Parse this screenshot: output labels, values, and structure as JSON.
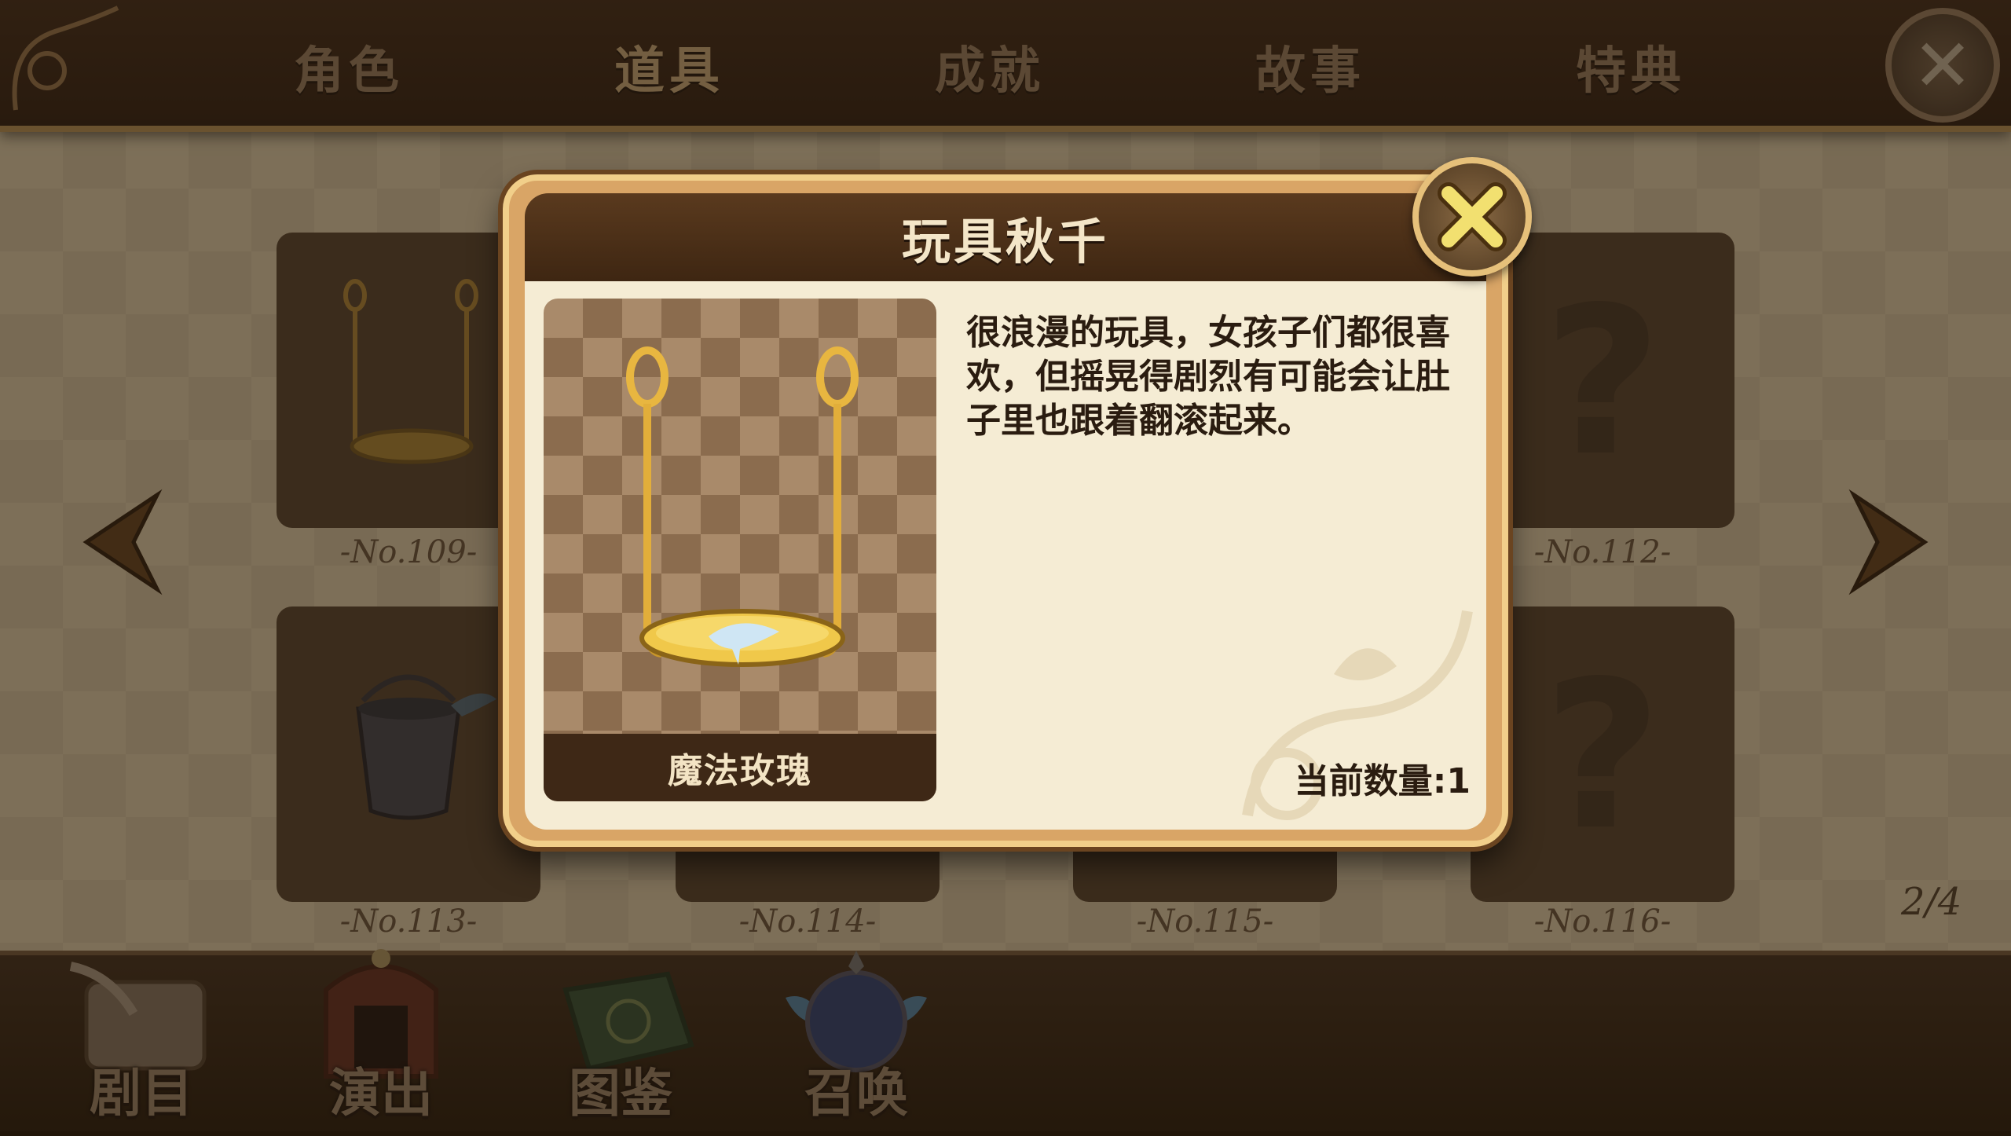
{
  "top_tabs": [
    {
      "label": "角色",
      "active": false
    },
    {
      "label": "道具",
      "active": true
    },
    {
      "label": "成就",
      "active": false
    },
    {
      "label": "故事",
      "active": false
    },
    {
      "label": "特典",
      "active": false
    }
  ],
  "top_close_glyph": "✕",
  "grid": {
    "slots": [
      {
        "number": "-No.109-",
        "content": "swing-icon"
      },
      {
        "number": "-No.112-",
        "content": "question-mark",
        "glyph": "?"
      },
      {
        "number": "-No.113-",
        "content": "bucket-icon"
      },
      {
        "number": "-No.114-",
        "content": "empty"
      },
      {
        "number": "-No.115-",
        "content": "empty"
      },
      {
        "number": "-No.116-",
        "content": "question-mark",
        "glyph": "?"
      }
    ],
    "page_indicator": "2/4"
  },
  "modal": {
    "title": "玩具秋千",
    "close_glyph": "✕",
    "item_name": "魔法玫瑰",
    "description": "很浪漫的玩具，女孩子们都很喜欢，但摇晃得剧烈有可能会让肚子里也跟着翻滚起来。",
    "quantity_label": "当前数量:1"
  },
  "bottom_nav": [
    {
      "label": "剧目",
      "icon": "scroll-icon"
    },
    {
      "label": "演出",
      "icon": "stage-icon"
    },
    {
      "label": "图鉴",
      "icon": "book-icon"
    },
    {
      "label": "召唤",
      "icon": "orb-icon"
    }
  ],
  "colors": {
    "frame_gold": "#f1cf8a",
    "header_brown": "#3e2612",
    "parchment": "#f5ecd4",
    "text_dark": "#2a1c10"
  }
}
